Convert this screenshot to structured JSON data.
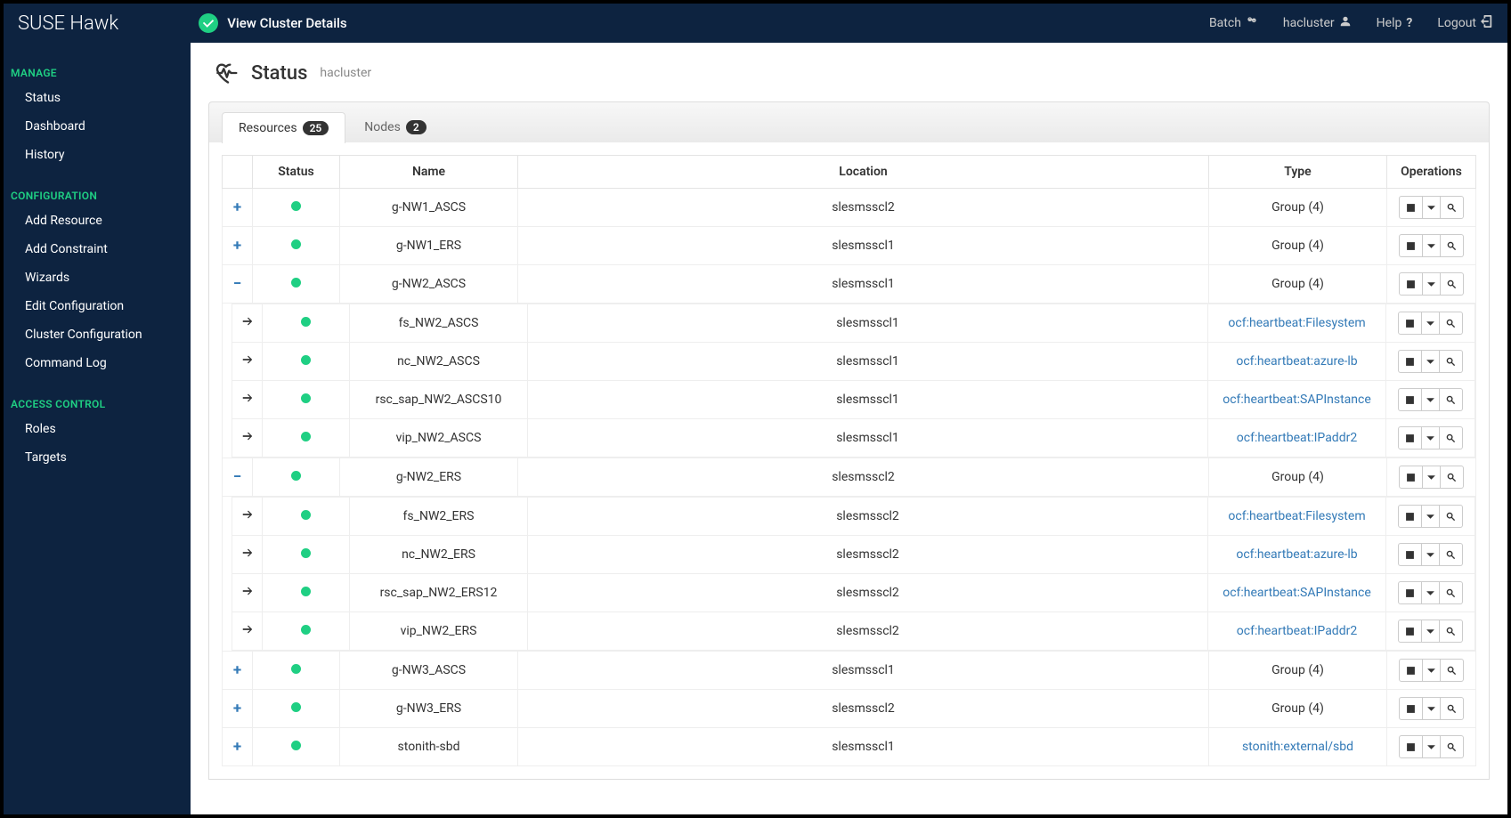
{
  "brand": "SUSE Hawk",
  "cluster_status_label": "View Cluster Details",
  "topbar": {
    "batch": "Batch",
    "user": "hacluster",
    "help": "Help",
    "logout": "Logout"
  },
  "sidebar": {
    "sections": [
      {
        "title": "MANAGE",
        "items": [
          "Status",
          "Dashboard",
          "History"
        ]
      },
      {
        "title": "CONFIGURATION",
        "items": [
          "Add Resource",
          "Add Constraint",
          "Wizards",
          "Edit Configuration",
          "Cluster Configuration",
          "Command Log"
        ]
      },
      {
        "title": "ACCESS CONTROL",
        "items": [
          "Roles",
          "Targets"
        ]
      }
    ]
  },
  "page": {
    "title": "Status",
    "subtitle": "hacluster"
  },
  "tabs": [
    {
      "label": "Resources",
      "count": "25",
      "active": true
    },
    {
      "label": "Nodes",
      "count": "2",
      "active": false
    }
  ],
  "columns": {
    "status": "Status",
    "name": "Name",
    "location": "Location",
    "type": "Type",
    "operations": "Operations"
  },
  "rows": [
    {
      "expand": "plus",
      "name": "g-NW1_ASCS",
      "location": "slesmsscl2",
      "type": "Group (4)",
      "typeLink": false
    },
    {
      "expand": "plus",
      "name": "g-NW1_ERS",
      "location": "slesmsscl1",
      "type": "Group (4)",
      "typeLink": false
    },
    {
      "expand": "minus",
      "name": "g-NW2_ASCS",
      "location": "slesmsscl1",
      "type": "Group (4)",
      "typeLink": false,
      "children": [
        {
          "name": "fs_NW2_ASCS",
          "location": "slesmsscl1",
          "type": "ocf:heartbeat:Filesystem"
        },
        {
          "name": "nc_NW2_ASCS",
          "location": "slesmsscl1",
          "type": "ocf:heartbeat:azure-lb"
        },
        {
          "name": "rsc_sap_NW2_ASCS10",
          "location": "slesmsscl1",
          "type": "ocf:heartbeat:SAPInstance"
        },
        {
          "name": "vip_NW2_ASCS",
          "location": "slesmsscl1",
          "type": "ocf:heartbeat:IPaddr2"
        }
      ]
    },
    {
      "expand": "minus",
      "name": "g-NW2_ERS",
      "location": "slesmsscl2",
      "type": "Group (4)",
      "typeLink": false,
      "children": [
        {
          "name": "fs_NW2_ERS",
          "location": "slesmsscl2",
          "type": "ocf:heartbeat:Filesystem"
        },
        {
          "name": "nc_NW2_ERS",
          "location": "slesmsscl2",
          "type": "ocf:heartbeat:azure-lb"
        },
        {
          "name": "rsc_sap_NW2_ERS12",
          "location": "slesmsscl2",
          "type": "ocf:heartbeat:SAPInstance"
        },
        {
          "name": "vip_NW2_ERS",
          "location": "slesmsscl2",
          "type": "ocf:heartbeat:IPaddr2"
        }
      ]
    },
    {
      "expand": "plus",
      "name": "g-NW3_ASCS",
      "location": "slesmsscl1",
      "type": "Group (4)",
      "typeLink": false
    },
    {
      "expand": "plus",
      "name": "g-NW3_ERS",
      "location": "slesmsscl2",
      "type": "Group (4)",
      "typeLink": false
    },
    {
      "expand": "plus",
      "name": "stonith-sbd",
      "location": "slesmsscl1",
      "type": "stonith:external/sbd",
      "typeLink": true
    }
  ]
}
